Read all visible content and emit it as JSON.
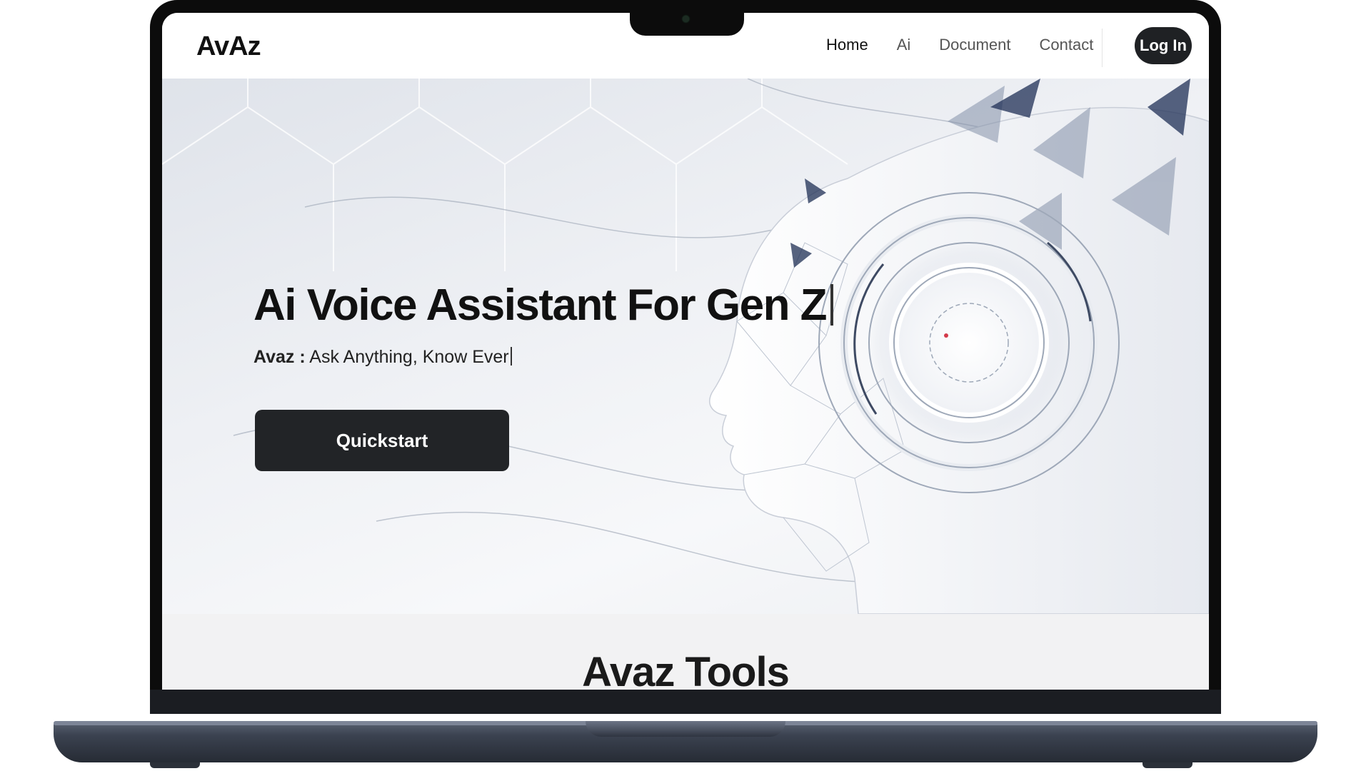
{
  "nav": {
    "brand": "AvAz",
    "links": [
      {
        "label": "Home",
        "active": true
      },
      {
        "label": "Ai",
        "active": false
      },
      {
        "label": "Document",
        "active": false
      },
      {
        "label": "Contact",
        "active": false
      }
    ],
    "login_label": "Log In"
  },
  "hero": {
    "title": "Ai Voice Assistant For Gen Z",
    "subtitle_prefix": "Avaz :",
    "subtitle_text": "Ask Anything, Know Ever",
    "cta_label": "Quickstart"
  },
  "tools": {
    "title": "Avaz Tools"
  },
  "colors": {
    "button_dark": "#222427",
    "accent_strip": "#3ed39a",
    "laptop_base": "#3b4250"
  },
  "icons": {
    "hero_art": "ai-head-illustration"
  }
}
